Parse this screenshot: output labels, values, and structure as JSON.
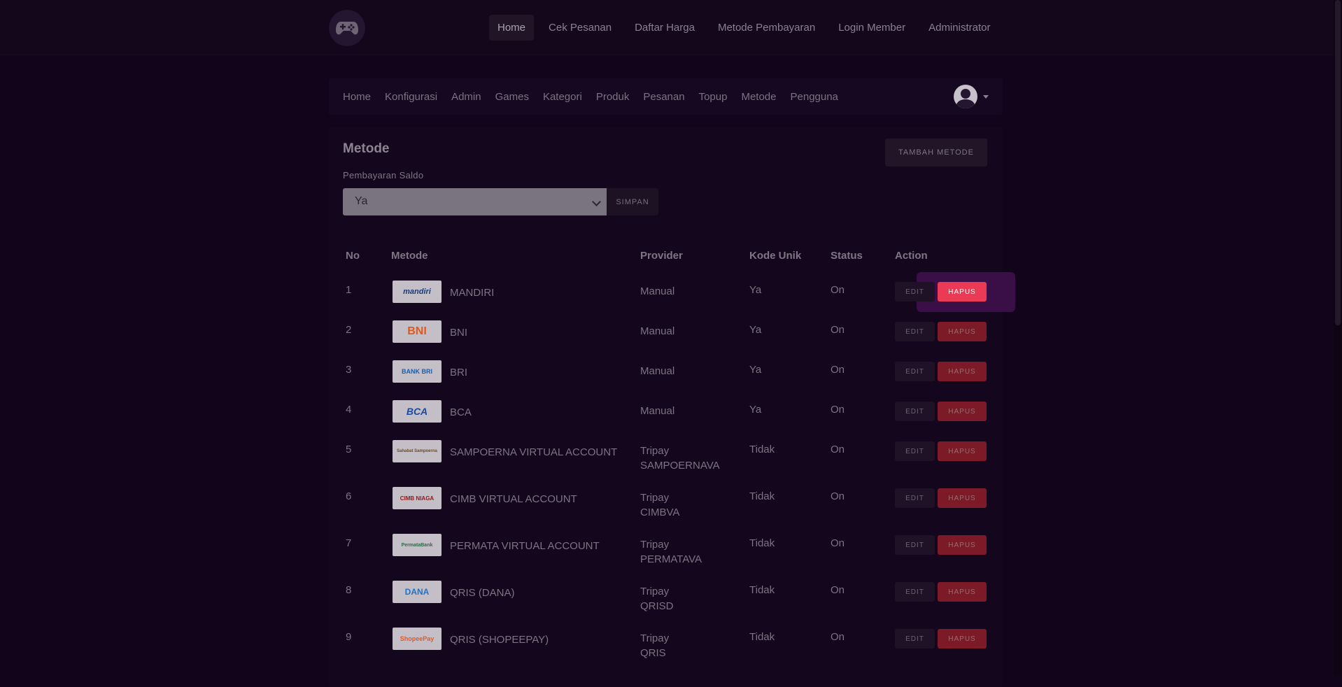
{
  "topnav": {
    "logo_icon": "gamepad-icon",
    "links": [
      "Home",
      "Cek Pesanan",
      "Daftar Harga",
      "Metode Pembayaran",
      "Login Member",
      "Administrator"
    ],
    "active": "Home"
  },
  "subnav": {
    "links": [
      "Home",
      "Konfigurasi",
      "Admin",
      "Games",
      "Kategori",
      "Produk",
      "Pesanan",
      "Topup",
      "Metode",
      "Pengguna"
    ]
  },
  "card": {
    "title": "Metode",
    "add_button": "TAMBAH METODE",
    "saldo_label": "Pembayaran Saldo",
    "saldo_value": "Ya",
    "save_button": "SIMPAN"
  },
  "table": {
    "headers": [
      "No",
      "Metode",
      "Provider",
      "Kode Unik",
      "Status",
      "Action"
    ],
    "edit_label": "EDIT",
    "delete_label": "HAPUS",
    "rows": [
      {
        "no": "1",
        "logo": "mandiri",
        "name": "MANDIRI",
        "provider_line1": "Manual",
        "provider_line2": "",
        "kode": "Ya",
        "status": "On"
      },
      {
        "no": "2",
        "logo": "BNI",
        "name": "BNI",
        "provider_line1": "Manual",
        "provider_line2": "",
        "kode": "Ya",
        "status": "On"
      },
      {
        "no": "3",
        "logo": "BANK BRI",
        "name": "BRI",
        "provider_line1": "Manual",
        "provider_line2": "",
        "kode": "Ya",
        "status": "On"
      },
      {
        "no": "4",
        "logo": "BCA",
        "name": "BCA",
        "provider_line1": "Manual",
        "provider_line2": "",
        "kode": "Ya",
        "status": "On"
      },
      {
        "no": "5",
        "logo": "Sahabat Sampoerna",
        "name": "SAMPOERNA VIRTUAL ACCOUNT",
        "provider_line1": "Tripay",
        "provider_line2": "SAMPOERNAVA",
        "kode": "Tidak",
        "status": "On"
      },
      {
        "no": "6",
        "logo": "CIMB NIAGA",
        "name": "CIMB VIRTUAL ACCOUNT",
        "provider_line1": "Tripay",
        "provider_line2": "CIMBVA",
        "kode": "Tidak",
        "status": "On"
      },
      {
        "no": "7",
        "logo": "PermataBank",
        "name": "PERMATA VIRTUAL ACCOUNT",
        "provider_line1": "Tripay",
        "provider_line2": "PERMATAVA",
        "kode": "Tidak",
        "status": "On"
      },
      {
        "no": "8",
        "logo": "DANA",
        "name": "QRIS (DANA)",
        "provider_line1": "Tripay",
        "provider_line2": "QRISD",
        "kode": "Tidak",
        "status": "On"
      },
      {
        "no": "9",
        "logo": "ShopeePay",
        "name": "QRIS (SHOPEEPAY)",
        "provider_line1": "Tripay",
        "provider_line2": "QRIS",
        "kode": "Tidak",
        "status": "On"
      }
    ]
  },
  "colors": {
    "background": "#12041a",
    "danger": "#ea3a55",
    "danger_dim": "#7d1a27",
    "highlight": "#3a0f47"
  }
}
